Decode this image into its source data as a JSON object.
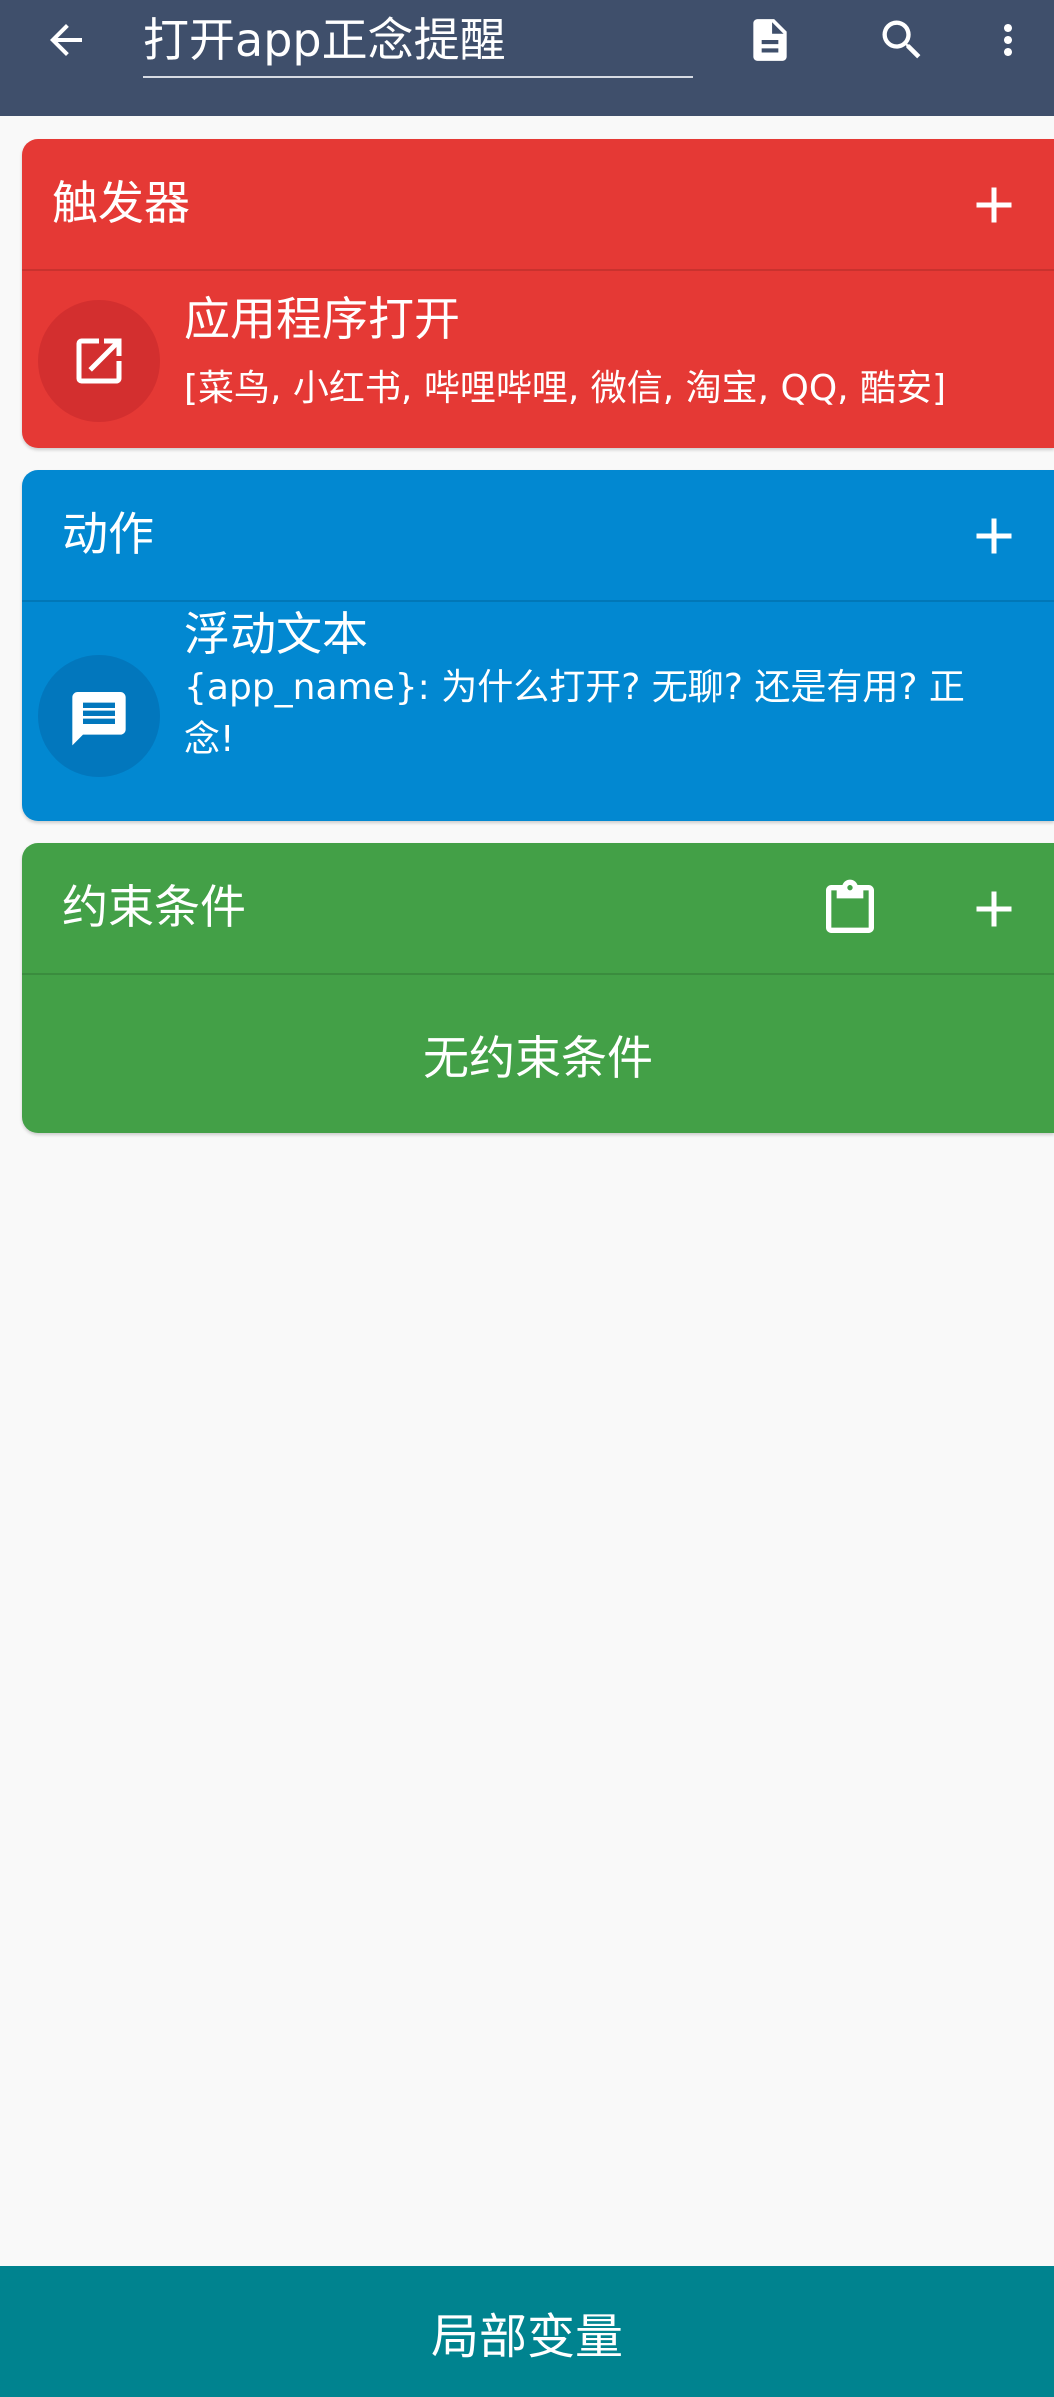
{
  "appbar": {
    "title": "打开app正念提醒",
    "background": "#3f4f6b",
    "icons": [
      "arrow-back-icon",
      "document-icon",
      "search-icon",
      "more-vertical-icon"
    ]
  },
  "trigger_section": {
    "title": "触发器",
    "color": "#e53935",
    "item": {
      "icon": "open-in-new-icon",
      "title": "应用程序打开",
      "subtitle": "[菜鸟, 小红书, 哔哩哔哩, 微信, 淘宝, QQ, 酷安]"
    }
  },
  "action_section": {
    "title": "动作",
    "color": "#0288d1",
    "item": {
      "icon": "message-icon",
      "title": "浮动文本",
      "subtitle": "{app_name}: 为什么打开? 无聊? 还是有用? 正念!"
    }
  },
  "constraint_section": {
    "title": "约束条件",
    "color": "#43a047",
    "empty_text": "无约束条件"
  },
  "bottom_bar": {
    "label": "局部变量",
    "color": "#00838f"
  }
}
